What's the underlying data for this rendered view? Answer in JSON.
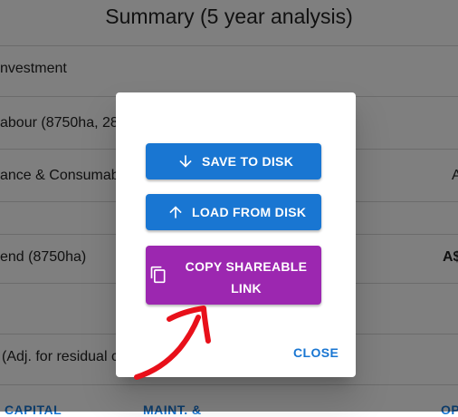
{
  "page": {
    "title": "Summary (5 year analysis)",
    "rows": [
      {
        "label": "nvestment",
        "value": ""
      },
      {
        "label": "abour (8750ha, 28",
        "value": ""
      },
      {
        "label": "ance & Consumab",
        "value": "A"
      },
      {
        "label": "",
        "value": ""
      },
      {
        "label": "end (8750ha)",
        "value": "A$"
      },
      {
        "label": "",
        "value": ""
      },
      {
        "label": "(Adj. for residual c",
        "value": ""
      }
    ],
    "footer_tabs": [
      "CAPITAL",
      "MAINT. &",
      "OP"
    ]
  },
  "dialog": {
    "save_label": "SAVE TO DISK",
    "load_label": "LOAD FROM DISK",
    "copy_label": "COPY SHAREABLE LINK",
    "close_label": "CLOSE"
  },
  "colors": {
    "primary": "#1976d2",
    "secondary": "#9c27b0",
    "annotation": "#e8101a"
  },
  "icons": {
    "save": "arrow-down-icon",
    "load": "arrow-up-icon",
    "copy": "copy-icon"
  }
}
